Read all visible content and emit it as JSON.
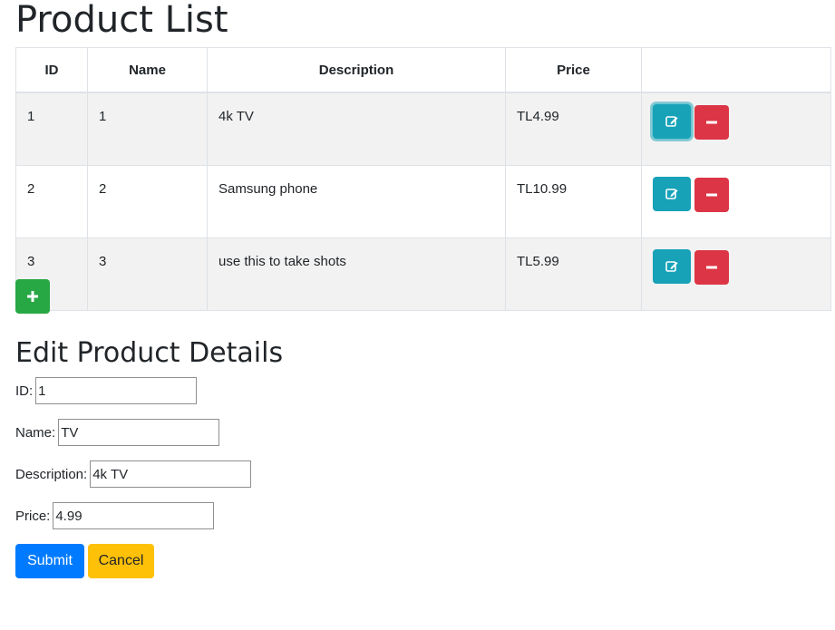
{
  "page_title": "Product List",
  "table": {
    "headers": [
      "ID",
      "Name",
      "Description",
      "Price",
      ""
    ],
    "rows": [
      {
        "id": "1",
        "name": "1",
        "description": "4k TV",
        "price": "TL4.99"
      },
      {
        "id": "2",
        "name": "2",
        "description": "Samsung phone",
        "price": "TL10.99"
      },
      {
        "id": "3",
        "name": "3",
        "description": "use this to take shots",
        "price": "TL5.99"
      }
    ],
    "edit_icon": "edit-icon",
    "delete_icon": "minus-icon"
  },
  "add_button_icon": "plus-icon",
  "form": {
    "title": "Edit Product Details",
    "id_label": "ID:",
    "id_value": "1",
    "name_label": "Name:",
    "name_value": "TV",
    "description_label": "Description:",
    "description_value": "4k TV",
    "price_label": "Price:",
    "price_value": "4.99",
    "submit_label": "Submit",
    "cancel_label": "Cancel"
  },
  "colors": {
    "edit": "#17a2b8",
    "delete": "#dc3545",
    "add": "#28a745",
    "submit": "#007bff",
    "cancel": "#ffc107"
  }
}
